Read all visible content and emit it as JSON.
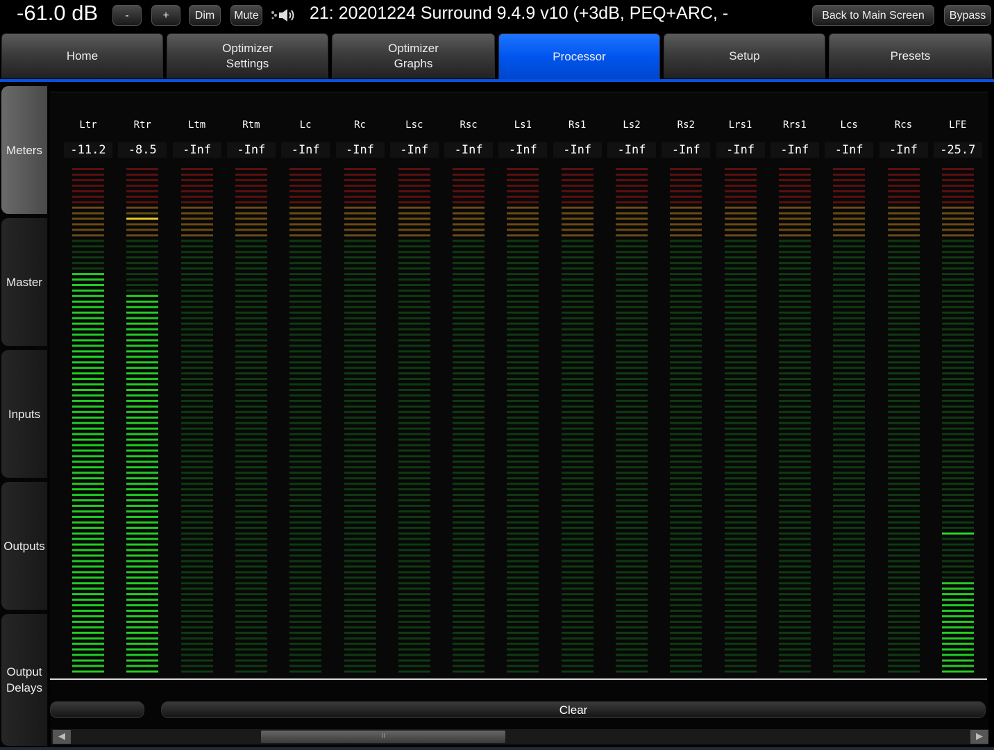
{
  "header": {
    "volume": "-61.0 dB",
    "minus_label": "-",
    "plus_label": "+",
    "dim_label": "Dim",
    "mute_label": "Mute",
    "preset_title": "21: 20201224 Surround 9.4.9 v10 (+3dB, PEQ+ARC, -",
    "back_label": "Back to Main Screen",
    "bypass_label": "Bypass"
  },
  "tabs": [
    {
      "line1": "Home",
      "line2": ""
    },
    {
      "line1": "Optimizer",
      "line2": "Settings"
    },
    {
      "line1": "Optimizer",
      "line2": "Graphs"
    },
    {
      "line1": "Processor",
      "line2": ""
    },
    {
      "line1": "Setup",
      "line2": ""
    },
    {
      "line1": "Presets",
      "line2": ""
    }
  ],
  "active_tab": "Processor",
  "sidebar": [
    {
      "line1": "Meters",
      "line2": ""
    },
    {
      "line1": "Master",
      "line2": ""
    },
    {
      "line1": "Inputs",
      "line2": ""
    },
    {
      "line1": "Outputs",
      "line2": ""
    },
    {
      "line1": "Output",
      "line2": "Delays"
    }
  ],
  "active_sidebar": "Meters",
  "channels": [
    {
      "label": "Ltr",
      "value": "-11.2",
      "level": 0.79,
      "peak": 0.37
    },
    {
      "label": "Rtr",
      "value": "-8.5",
      "level": 0.75,
      "peak": 0.1
    },
    {
      "label": "Ltm",
      "value": "-Inf",
      "level": 0,
      "peak": null
    },
    {
      "label": "Rtm",
      "value": "-Inf",
      "level": 0,
      "peak": null
    },
    {
      "label": "Lc",
      "value": "-Inf",
      "level": 0,
      "peak": null
    },
    {
      "label": "Rc",
      "value": "-Inf",
      "level": 0,
      "peak": null
    },
    {
      "label": "Lsc",
      "value": "-Inf",
      "level": 0,
      "peak": null
    },
    {
      "label": "Rsc",
      "value": "-Inf",
      "level": 0,
      "peak": null
    },
    {
      "label": "Ls1",
      "value": "-Inf",
      "level": 0,
      "peak": null
    },
    {
      "label": "Rs1",
      "value": "-Inf",
      "level": 0,
      "peak": null
    },
    {
      "label": "Ls2",
      "value": "-Inf",
      "level": 0,
      "peak": null
    },
    {
      "label": "Rs2",
      "value": "-Inf",
      "level": 0,
      "peak": null
    },
    {
      "label": "Lrs1",
      "value": "-Inf",
      "level": 0,
      "peak": null
    },
    {
      "label": "Rrs1",
      "value": "-Inf",
      "level": 0,
      "peak": null
    },
    {
      "label": "Lcs",
      "value": "-Inf",
      "level": 0,
      "peak": null
    },
    {
      "label": "Rcs",
      "value": "-Inf",
      "level": 0,
      "peak": null
    },
    {
      "label": "LFE",
      "value": "-25.7",
      "level": 0.18,
      "peak": 0.72
    }
  ],
  "bottom": {
    "clear_label": "Clear",
    "scroll_thumb_glyph": "II"
  },
  "colors": {
    "active_tab": "#0055ee",
    "meter_green": "#22cc22",
    "meter_yellow": "#ccaa22",
    "meter_red": "#aa2222"
  }
}
